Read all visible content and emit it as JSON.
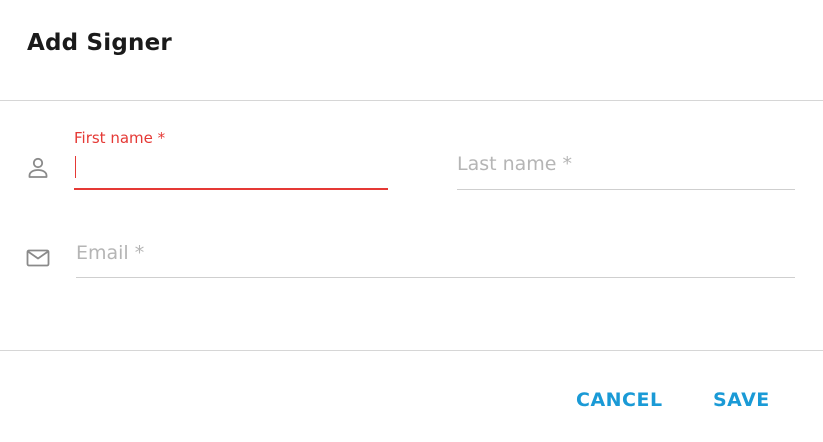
{
  "dialog": {
    "title": "Add Signer"
  },
  "form": {
    "first_name": {
      "label": "First name *",
      "value": ""
    },
    "last_name": {
      "label": "Last name *",
      "value": ""
    },
    "email": {
      "label": "Email *",
      "value": ""
    }
  },
  "icons": {
    "person": "person-outline-icon",
    "mail": "mail-outline-icon"
  },
  "actions": {
    "cancel_label": "CANCEL",
    "save_label": "SAVE"
  },
  "colors": {
    "accent": "#1a9ad6",
    "error": "#e53935",
    "placeholder": "#b5b5b5",
    "divider": "#d6d6d6",
    "title": "#1a1a1a",
    "icon": "#8a8a8a"
  }
}
